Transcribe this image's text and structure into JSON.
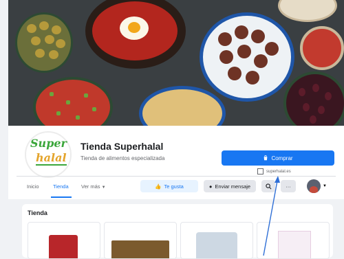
{
  "page": {
    "name": "Tienda Superhalal",
    "description": "Tienda de alimentos especializada",
    "logo_text_top": "Super",
    "logo_text_bottom": "halal"
  },
  "actions": {
    "buy_label": "Comprar",
    "website": "superhalal.es"
  },
  "tabs": [
    {
      "label": "Inicio",
      "active": false
    },
    {
      "label": "Tienda",
      "active": true
    },
    {
      "label": "Ver más",
      "active": false
    }
  ],
  "buttons": {
    "like_label": "Te gusta",
    "message_label": "Enviar mensaje",
    "more_label": "···"
  },
  "icons": {
    "buy": "bag-icon",
    "website": "external-link-icon",
    "like": "thumbs-up-icon",
    "message": "messenger-icon",
    "search": "search-icon",
    "more": "more-icon",
    "profile": "avatar-dropdown-icon"
  },
  "colors": {
    "accent": "#1877f2",
    "annotation_arrow": "#2f6fd6"
  },
  "shop": {
    "title": "Tienda",
    "products": [
      {
        "name": "product-1"
      },
      {
        "name": "product-2"
      },
      {
        "name": "product-3"
      },
      {
        "name": "product-4"
      }
    ]
  }
}
